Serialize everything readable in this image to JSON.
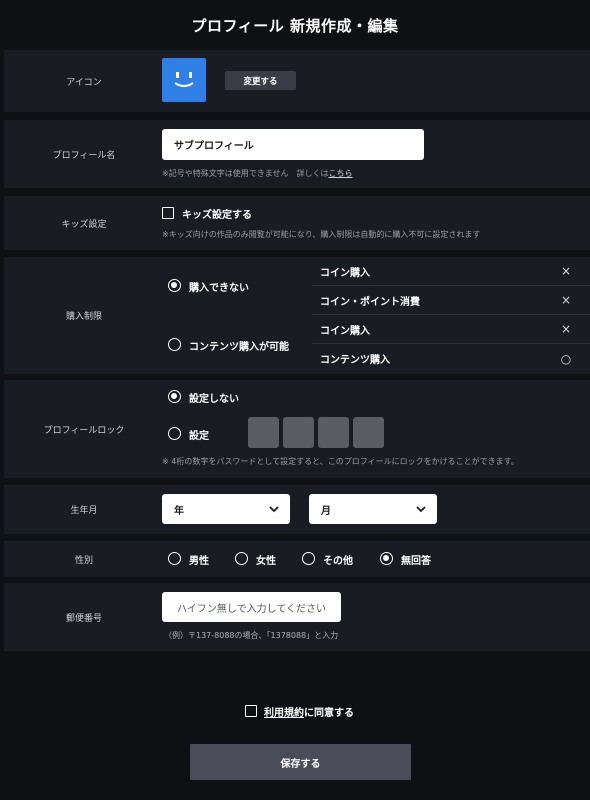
{
  "page_title": "プロフィール 新規作成・編集",
  "icon_section": {
    "label": "アイコン",
    "change_button": "変更する"
  },
  "profile_name": {
    "label": "プロフィール名",
    "value": "サブプロフィール",
    "note": "※記号や特殊文字は使用できません　詳しくは",
    "note_link": "こちら"
  },
  "kids": {
    "label": "キッズ設定",
    "checkbox_label": "キッズ設定する",
    "note": "※キッズ向けの作品のみ閲覧が可能になり、購入制限は自動的に購入不可に設定されます"
  },
  "purchase_limit": {
    "label": "購入制限",
    "options": [
      {
        "label": "購入できない",
        "selected": true
      },
      {
        "label": "コンテンツ購入が可能",
        "selected": false
      }
    ],
    "table": [
      {
        "label": "コイン購入",
        "mark": "×"
      },
      {
        "label": "コイン・ポイント消費",
        "mark": "×"
      },
      {
        "label": "コイン購入",
        "mark": "×"
      },
      {
        "label": "コンテンツ購入",
        "mark": "○"
      }
    ]
  },
  "profile_lock": {
    "label": "プロフィールロック",
    "options": [
      {
        "label": "設定しない",
        "selected": true
      },
      {
        "label": "設定",
        "selected": false
      }
    ],
    "pin_digits": 4,
    "note": "※ 4桁の数字をパスワードとして設定すると、このプロフィールにロックをかけることができます。"
  },
  "birth": {
    "label": "生年月",
    "year": {
      "value": "年"
    },
    "month": {
      "value": "月"
    }
  },
  "gender": {
    "label": "性別",
    "options": [
      {
        "label": "男性",
        "selected": false
      },
      {
        "label": "女性",
        "selected": false
      },
      {
        "label": "その他",
        "selected": false
      },
      {
        "label": "無回答",
        "selected": true
      }
    ]
  },
  "postal": {
    "label": "郵便番号",
    "placeholder": "ハイフン無しで入力してください",
    "note": "（例）〒137-8088の場合、「1378088」と入力"
  },
  "terms": {
    "link": "利用規約",
    "suffix": "に同意する",
    "checked": false
  },
  "save_button": "保存する",
  "colors": {
    "background": "#0f1014",
    "row": "#1a1c24",
    "accent_avatar": "#2f7fe6",
    "button": "#4a4d59"
  }
}
